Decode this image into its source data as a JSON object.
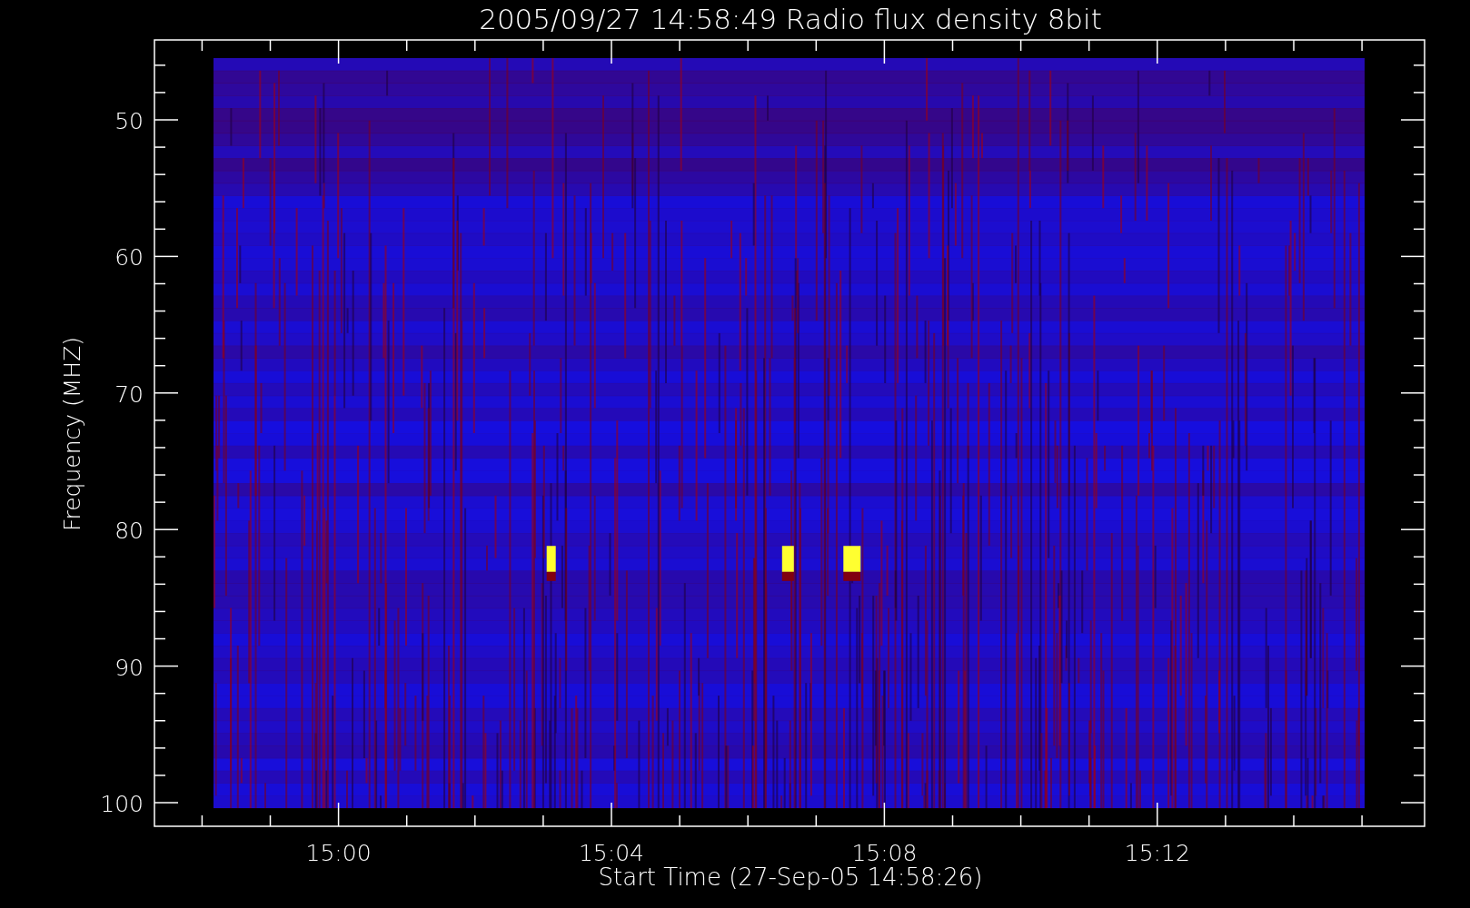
{
  "title": "2005/09/27 14:58:49 Radio flux density 8bit",
  "plot": {
    "ylabel": "Frequency (MHZ)",
    "xlabel": "Start Time (27-Sep-05 14:58:26)",
    "yticks": [
      "50",
      "60",
      "70",
      "80",
      "90",
      "100"
    ],
    "xticks": [
      "15:00",
      "15:04",
      "15:08",
      "15:12"
    ]
  }
}
